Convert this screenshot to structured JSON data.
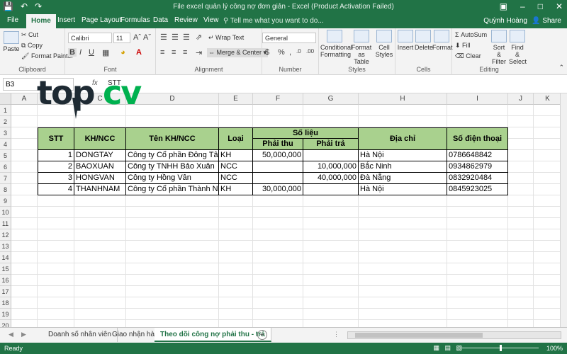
{
  "window": {
    "title": "File excel quản lý công nợ đơn giản - Excel (Product Activation Failed)",
    "user": "Quỳnh Hoàng",
    "share": "Share"
  },
  "ribbon_tabs": [
    "File",
    "Home",
    "Insert",
    "Page Layout",
    "Formulas",
    "Data",
    "Review",
    "View"
  ],
  "tell_me": "Tell me what you want to do...",
  "ribbon": {
    "clipboard": {
      "label": "Clipboard",
      "paste": "Paste",
      "cut": "Cut",
      "copy": "Copy",
      "format_painter": "Format Painter"
    },
    "font": {
      "label": "Font",
      "name": "Calibri",
      "size": "11"
    },
    "alignment": {
      "label": "Alignment",
      "wrap_text": "Wrap Text",
      "merge_center": "Merge & Center"
    },
    "number": {
      "label": "Number",
      "format": "General"
    },
    "styles": {
      "label": "Styles",
      "conditional": "Conditional Formatting",
      "format_as_table": "Format as Table",
      "cell_styles": "Cell Styles"
    },
    "cells": {
      "label": "Cells",
      "insert": "Insert",
      "delete": "Delete",
      "format": "Format"
    },
    "editing": {
      "label": "Editing",
      "autosum": "AutoSum",
      "fill": "Fill",
      "clear": "Clear",
      "sort_filter": "Sort & Filter",
      "find_select": "Find & Select"
    }
  },
  "formula_bar": {
    "name_box": "B3",
    "fx": "fx",
    "content": "STT"
  },
  "logo": {
    "part1": "top",
    "part2": "cv"
  },
  "columns": [
    "A",
    "B",
    "C",
    "D",
    "E",
    "F",
    "G",
    "H",
    "I",
    "J",
    "K"
  ],
  "rows": [
    "1",
    "2",
    "3",
    "4",
    "5",
    "6",
    "7",
    "8",
    "9",
    "10",
    "11",
    "12",
    "13",
    "14",
    "15",
    "16",
    "17",
    "18",
    "19",
    "20"
  ],
  "table": {
    "headers": {
      "stt": "STT",
      "khncc": "KH/NCC",
      "ten": "Tên KH/NCC",
      "loai": "Loại",
      "solieu": "Số liệu",
      "phaithu": "Phải thu",
      "phaitra": "Phải trả",
      "diachi": "Địa chỉ",
      "sdt": "Số điện thoại"
    },
    "rows": [
      {
        "stt": "1",
        "code": "DONGTAY",
        "name": "Công ty Cổ phần Đông Tây",
        "type": "KH",
        "thu": "50,000,000",
        "tra": "",
        "addr": "Hà Nội",
        "phone": "0786648842"
      },
      {
        "stt": "2",
        "code": "BAOXUAN",
        "name": "Công ty TNHH Bảo Xuân",
        "type": "NCC",
        "thu": "",
        "tra": "10,000,000",
        "addr": "Bắc Ninh",
        "phone": "0934862979"
      },
      {
        "stt": "3",
        "code": "HONGVAN",
        "name": "Công ty Hồng Vân",
        "type": "NCC",
        "thu": "",
        "tra": "40,000,000",
        "addr": "Đà Nẵng",
        "phone": "0832920484"
      },
      {
        "stt": "4",
        "code": "THANHNAM",
        "name": "Công ty Cổ phần Thành Nam",
        "type": "KH",
        "thu": "30,000,000",
        "tra": "",
        "addr": "Hà Nội",
        "phone": "0845923025"
      }
    ]
  },
  "sheets": [
    "Doanh số nhân viên",
    "Giao nhận hàng",
    "Theo dõi công nợ phải thu - trả"
  ],
  "status": {
    "ready": "Ready",
    "zoom": "100%"
  },
  "colors": {
    "excel_green": "#217346",
    "header_fill": "#a9d18e",
    "logo_dark": "#1e2a33",
    "logo_green": "#00b14f"
  }
}
